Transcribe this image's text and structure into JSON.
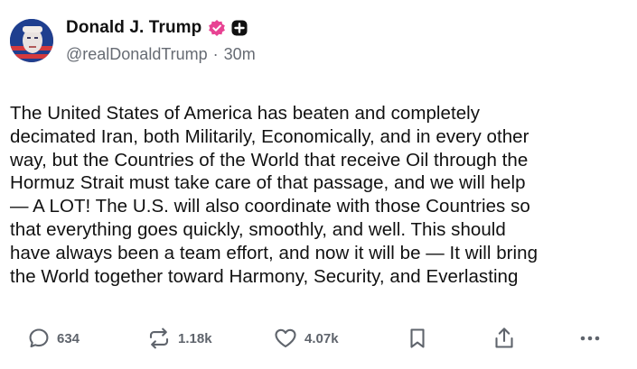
{
  "author": {
    "display_name": "Donald J. Trump",
    "handle": "@realDonaldTrump",
    "separator": "·",
    "time_ago": "30m",
    "verified_color": "#e84393"
  },
  "post": {
    "text": "The United States of America has beaten and completely\ndecimated Iran, both Militarily, Economically, and in every other\nway, but the Countries of the World that receive Oil through the\nHormuz Strait must take care of that passage, and we will help\n— A LOT! The U.S. will also coordinate with those Countries so\nthat everything goes quickly, smoothly, and well. This should\nhave always been a team effort, and now it will be — It will bring\nthe World together toward Harmony, Security, and Everlasting"
  },
  "actions": {
    "reply": {
      "icon": "comment-icon",
      "count": "634"
    },
    "repost": {
      "icon": "repost-icon",
      "count": "1.18k"
    },
    "like": {
      "icon": "heart-icon",
      "count": "4.07k"
    },
    "bookmark": {
      "icon": "bookmark-icon"
    },
    "share": {
      "icon": "share-icon"
    },
    "more": {
      "icon": "more-icon"
    }
  }
}
